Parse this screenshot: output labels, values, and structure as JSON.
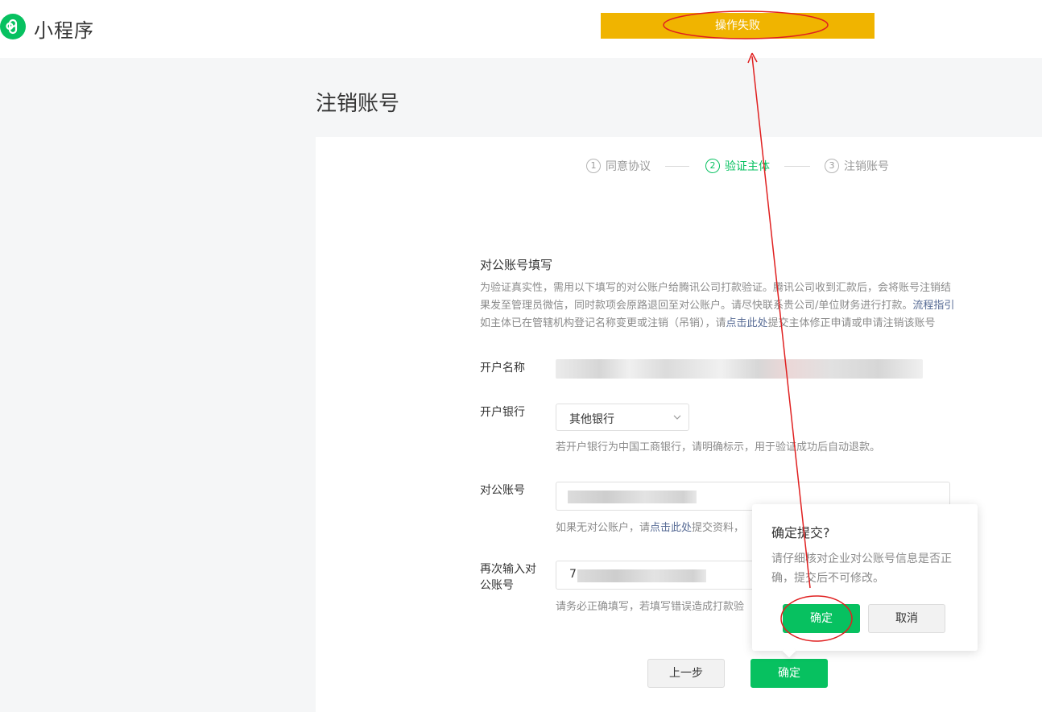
{
  "header": {
    "app_name": "小程序",
    "logo_icon": "mini-program-logo-icon"
  },
  "toast": {
    "text": "操作失败",
    "color": "#f0b400"
  },
  "page": {
    "title": "注销账号"
  },
  "steps": [
    {
      "num": "1",
      "label": "同意协议",
      "active": false
    },
    {
      "num": "2",
      "label": "验证主体",
      "active": true
    },
    {
      "num": "3",
      "label": "注销账号",
      "active": false
    }
  ],
  "section": {
    "title": "对公账号填写",
    "desc_line1": "为验证真实性，需用以下填写的对公账户给腾讯公司打款验证。腾讯公司收到汇款后，会将账号注销结",
    "desc_line2_pre": "果发至管理员微信，同时款项会原路退回至对公账户。请尽快联系贵公司/单位财务进行打款。",
    "desc_line2_link": "流程指引",
    "desc_line3_pre": "如主体已在管辖机构登记名称变更或注销（吊销），请",
    "desc_line3_link": "点击此处",
    "desc_line3_post": "提交主体修正申请或申请注销该账号"
  },
  "form": {
    "account_name_label": "开户名称",
    "bank_label": "开户银行",
    "bank_value": "其他银行",
    "bank_hint": "若开户银行为中国工商银行，请明确标示，用于验证成功后自动退款。",
    "account_label": "对公账号",
    "account_hint_pre": "如果无对公账户，请",
    "account_hint_link": "点击此处",
    "account_hint_post": "提交资料，",
    "reenter_label_line1": "再次输入对",
    "reenter_label_line2": "公账号",
    "reenter_value_prefix": "7",
    "reenter_hint": "请务必正确填写，若填写错误造成打款验"
  },
  "buttons": {
    "prev": "上一步",
    "confirm": "确定"
  },
  "popover": {
    "title": "确定提交?",
    "text": "请仔细核对企业对公账号信息是否正确，提交后不可修改。",
    "confirm": "确定",
    "cancel": "取消"
  },
  "colors": {
    "primary": "#07c160",
    "link": "#576b95",
    "annotation": "#e02020"
  }
}
